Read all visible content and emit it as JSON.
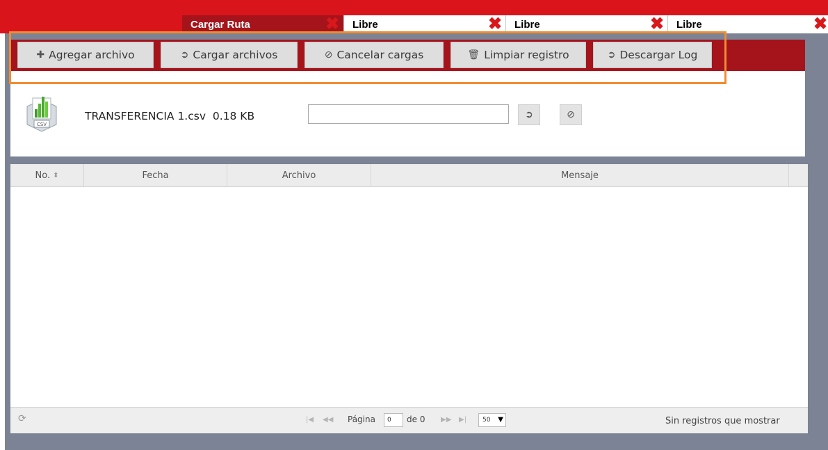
{
  "tabs": [
    {
      "label": "Cargar Ruta",
      "active": true
    },
    {
      "label": "Libre",
      "active": false
    },
    {
      "label": "Libre",
      "active": false
    },
    {
      "label": "Libre",
      "active": false
    }
  ],
  "toolbar": {
    "add_file": "Agregar archivo",
    "upload_files": "Cargar archivos",
    "cancel_uploads": "Cancelar cargas",
    "clear_log": "Limpiar registro",
    "download_log": "Descargar Log"
  },
  "upload": {
    "file_name": "TRANSFERENCIA 1.csv",
    "file_size": "0.18 KB",
    "file_type_label": "CSV"
  },
  "grid": {
    "columns": [
      "No.",
      "Fecha",
      "Archivo",
      "Mensaje"
    ],
    "rows": []
  },
  "pager": {
    "page_label": "Página",
    "page_value": "0",
    "of_label": "de 0",
    "page_size": "50",
    "status": "Sin registros que mostrar"
  },
  "colors": {
    "header_red": "#d9151b",
    "toolbar_dark_red": "#a5131b",
    "highlight_orange": "#f08c33",
    "frame_grey": "#7b8394"
  },
  "icons": {
    "tab_close": "close-x-icon",
    "add": "plus-icon",
    "upload": "arrow-circle-icon",
    "cancel": "cancel-icon",
    "clear": "trash-icon",
    "download": "arrow-circle-icon",
    "refresh": "refresh-icon"
  }
}
